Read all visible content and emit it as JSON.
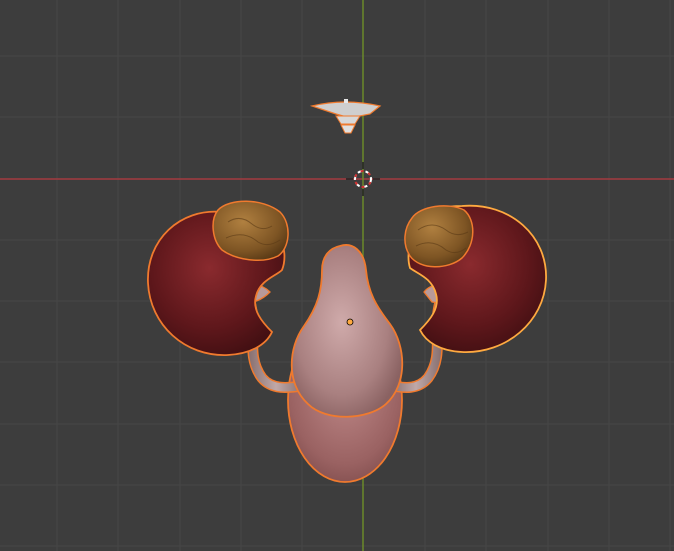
{
  "viewport": {
    "background": "#3d3d3d",
    "grid_color": "#474747",
    "x_axis_color": "#a33b40",
    "y_axis_color": "#6b8a2a",
    "selection_outline_color": "#f07a2e",
    "active_outline_color": "#ffaa40"
  },
  "scene": {
    "objects": [
      {
        "name": "light",
        "kind": "light-icon",
        "selected": false
      },
      {
        "name": "3d-cursor",
        "kind": "cursor-icon",
        "selected": false
      },
      {
        "name": "kidney-left",
        "kind": "mesh",
        "selected": true,
        "color": "#6a1c1f"
      },
      {
        "name": "kidney-right",
        "kind": "mesh",
        "selected": true,
        "color": "#6a1c1f"
      },
      {
        "name": "adrenal-gland-left",
        "kind": "mesh",
        "selected": true,
        "color": "#8a5e2a"
      },
      {
        "name": "adrenal-gland-right",
        "kind": "mesh",
        "selected": true,
        "color": "#8a5e2a"
      },
      {
        "name": "ureter-left",
        "kind": "mesh",
        "selected": true,
        "color": "#a48a8a"
      },
      {
        "name": "ureter-right",
        "kind": "mesh",
        "selected": true,
        "color": "#a48a8a"
      },
      {
        "name": "bladder",
        "kind": "mesh",
        "selected": true,
        "color": "#b98c8c"
      },
      {
        "name": "bladder-base",
        "kind": "mesh",
        "selected": true,
        "color": "#a86b6b"
      }
    ]
  }
}
